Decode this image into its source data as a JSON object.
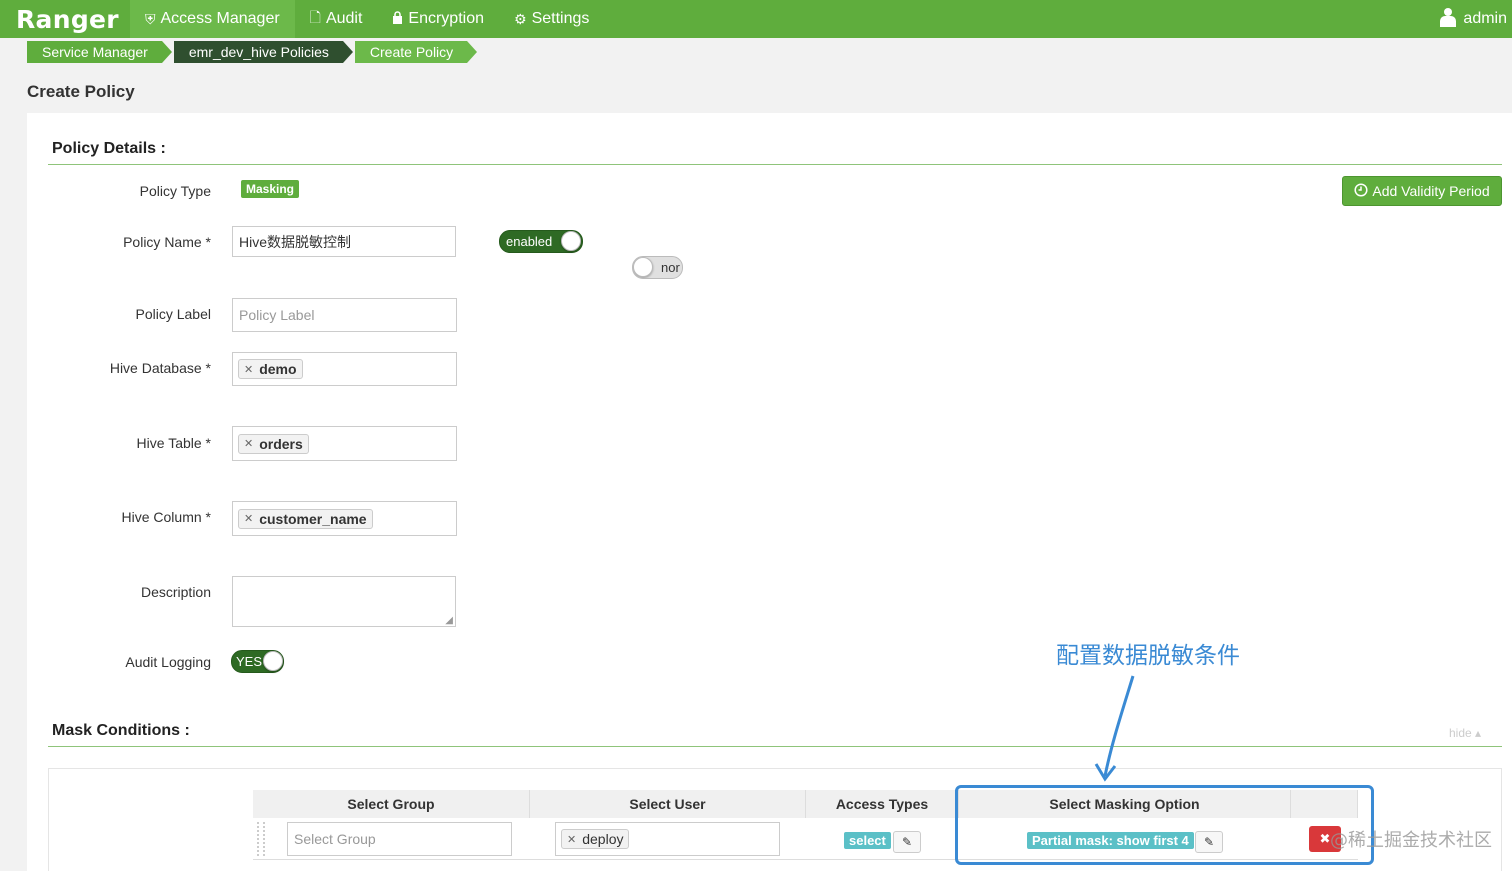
{
  "nav": {
    "brand": "Ranger",
    "items": [
      {
        "label": "Access Manager",
        "icon": "shield-icon"
      },
      {
        "label": "Audit",
        "icon": "file-icon"
      },
      {
        "label": "Encryption",
        "icon": "lock-icon"
      },
      {
        "label": "Settings",
        "icon": "gear-icon"
      }
    ],
    "user": "admin"
  },
  "breadcrumb": [
    "Service Manager",
    "emr_dev_hive Policies",
    "Create Policy"
  ],
  "page_title": "Create Policy",
  "policy_details": {
    "title": "Policy Details :",
    "policy_type_label": "Policy Type",
    "policy_type_value": "Masking",
    "add_validity_label": "Add Validity Period",
    "policy_name_label": "Policy Name *",
    "policy_name_value": "Hive数据脱敏控制",
    "enabled_label": "enabled",
    "normal_label": "nor",
    "policy_label_label": "Policy Label",
    "policy_label_placeholder": "Policy Label",
    "hive_database_label": "Hive Database *",
    "hive_database_value": "demo",
    "hive_table_label": "Hive Table *",
    "hive_table_value": "orders",
    "hive_column_label": "Hive Column *",
    "hive_column_value": "customer_name",
    "description_label": "Description",
    "audit_logging_label": "Audit Logging",
    "audit_logging_value": "YES"
  },
  "mask_conditions": {
    "title": "Mask Conditions :",
    "hide_label": "hide",
    "columns": [
      "Select Group",
      "Select User",
      "Access Types",
      "Select Masking Option"
    ],
    "row": {
      "group_placeholder": "Select Group",
      "user": "deploy",
      "access_type": "select",
      "masking_option": "Partial mask: show first 4"
    }
  },
  "annotation": "配置数据脱敏条件",
  "watermark": "@稀土掘金技术社区",
  "colors": {
    "nav_green": "#5fad3d",
    "dark_green": "#2e6a24",
    "teal_badge": "#5bc0c7",
    "annotation_blue": "#3a8ad4",
    "delete_red": "#d9383a"
  }
}
